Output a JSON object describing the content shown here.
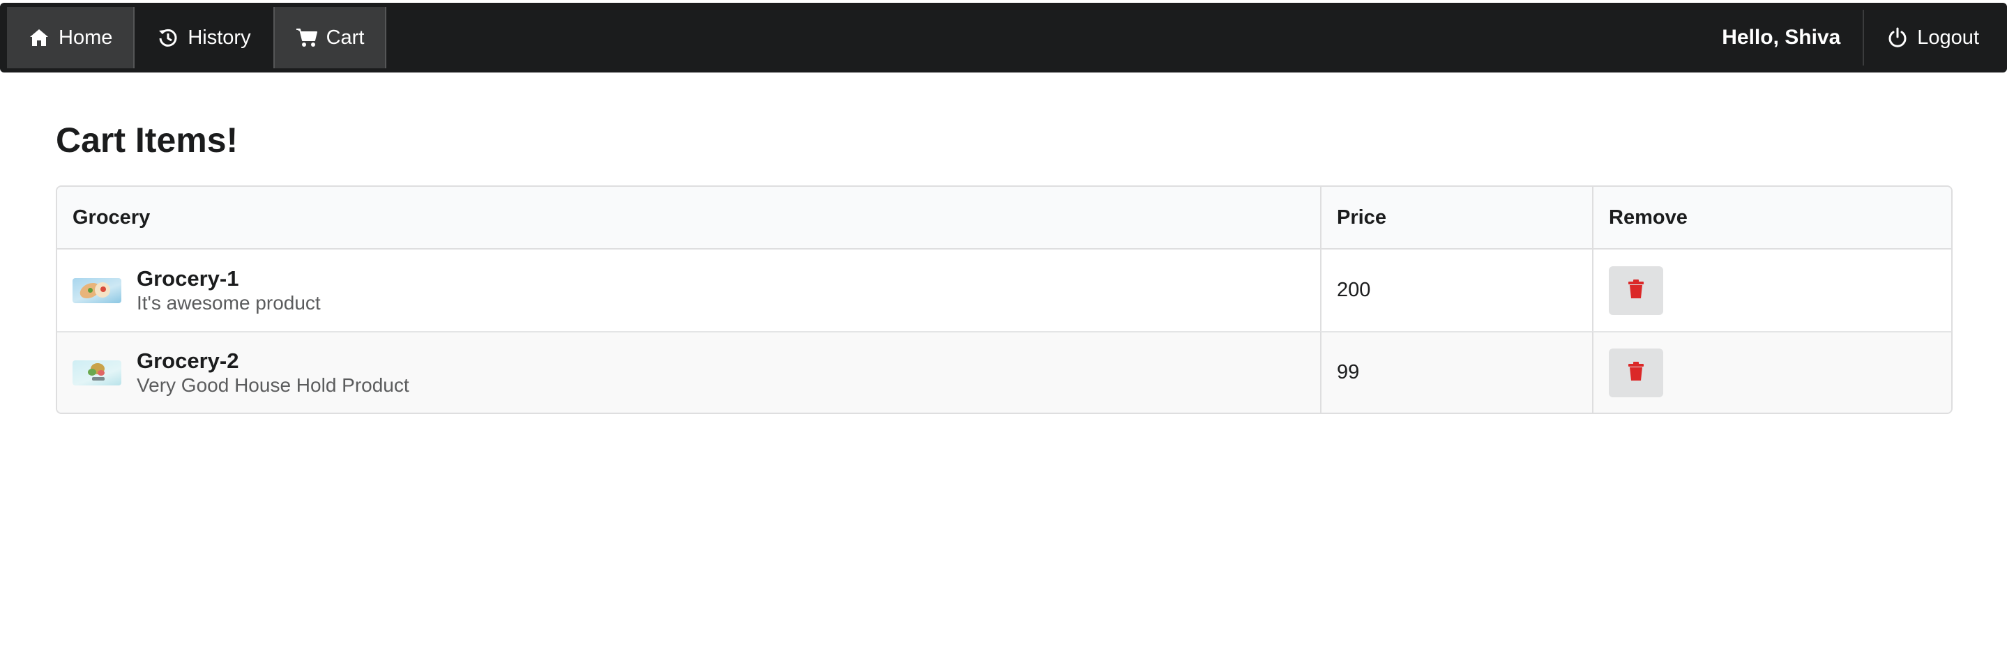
{
  "nav": {
    "home_label": "Home",
    "history_label": "History",
    "cart_label": "Cart",
    "greeting": "Hello, Shiva",
    "logout_label": "Logout"
  },
  "main": {
    "title": "Cart Items!",
    "table": {
      "headers": [
        "Grocery",
        "Price",
        "Remove"
      ],
      "rows": [
        {
          "name": "Grocery-1",
          "description": "It's awesome product",
          "price": "200"
        },
        {
          "name": "Grocery-2",
          "description": "Very Good House Hold Product",
          "price": "99"
        }
      ]
    }
  },
  "icons": {
    "home": "home-icon",
    "history": "history-icon",
    "cart": "cart-icon",
    "logout": "power-icon",
    "remove": "trash-icon"
  },
  "colors": {
    "navbar": "#1b1c1d",
    "active_tab": "#3a3b3c",
    "trash": "#db2828",
    "button": "#e0e1e2"
  }
}
